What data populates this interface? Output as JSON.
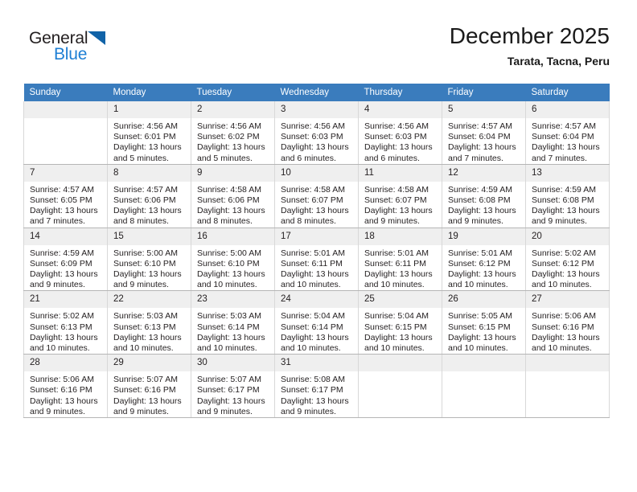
{
  "brand": {
    "name_part1": "General",
    "name_part2": "Blue",
    "logo_icon": "blue-triangle-icon"
  },
  "header": {
    "title": "December 2025",
    "location": "Tarata, Tacna, Peru"
  },
  "calendar": {
    "weekday_headers": [
      "Sunday",
      "Monday",
      "Tuesday",
      "Wednesday",
      "Thursday",
      "Friday",
      "Saturday"
    ],
    "labels": {
      "sunrise": "Sunrise:",
      "sunset": "Sunset:",
      "daylight": "Daylight:"
    },
    "weeks": [
      [
        {
          "day": "",
          "empty": true
        },
        {
          "day": "1",
          "sunrise": "Sunrise: 4:56 AM",
          "sunset": "Sunset: 6:01 PM",
          "daylight_line1": "Daylight: 13 hours",
          "daylight_line2": "and 5 minutes."
        },
        {
          "day": "2",
          "sunrise": "Sunrise: 4:56 AM",
          "sunset": "Sunset: 6:02 PM",
          "daylight_line1": "Daylight: 13 hours",
          "daylight_line2": "and 5 minutes."
        },
        {
          "day": "3",
          "sunrise": "Sunrise: 4:56 AM",
          "sunset": "Sunset: 6:03 PM",
          "daylight_line1": "Daylight: 13 hours",
          "daylight_line2": "and 6 minutes."
        },
        {
          "day": "4",
          "sunrise": "Sunrise: 4:56 AM",
          "sunset": "Sunset: 6:03 PM",
          "daylight_line1": "Daylight: 13 hours",
          "daylight_line2": "and 6 minutes."
        },
        {
          "day": "5",
          "sunrise": "Sunrise: 4:57 AM",
          "sunset": "Sunset: 6:04 PM",
          "daylight_line1": "Daylight: 13 hours",
          "daylight_line2": "and 7 minutes."
        },
        {
          "day": "6",
          "sunrise": "Sunrise: 4:57 AM",
          "sunset": "Sunset: 6:04 PM",
          "daylight_line1": "Daylight: 13 hours",
          "daylight_line2": "and 7 minutes."
        }
      ],
      [
        {
          "day": "7",
          "sunrise": "Sunrise: 4:57 AM",
          "sunset": "Sunset: 6:05 PM",
          "daylight_line1": "Daylight: 13 hours",
          "daylight_line2": "and 7 minutes."
        },
        {
          "day": "8",
          "sunrise": "Sunrise: 4:57 AM",
          "sunset": "Sunset: 6:06 PM",
          "daylight_line1": "Daylight: 13 hours",
          "daylight_line2": "and 8 minutes."
        },
        {
          "day": "9",
          "sunrise": "Sunrise: 4:58 AM",
          "sunset": "Sunset: 6:06 PM",
          "daylight_line1": "Daylight: 13 hours",
          "daylight_line2": "and 8 minutes."
        },
        {
          "day": "10",
          "sunrise": "Sunrise: 4:58 AM",
          "sunset": "Sunset: 6:07 PM",
          "daylight_line1": "Daylight: 13 hours",
          "daylight_line2": "and 8 minutes."
        },
        {
          "day": "11",
          "sunrise": "Sunrise: 4:58 AM",
          "sunset": "Sunset: 6:07 PM",
          "daylight_line1": "Daylight: 13 hours",
          "daylight_line2": "and 9 minutes."
        },
        {
          "day": "12",
          "sunrise": "Sunrise: 4:59 AM",
          "sunset": "Sunset: 6:08 PM",
          "daylight_line1": "Daylight: 13 hours",
          "daylight_line2": "and 9 minutes."
        },
        {
          "day": "13",
          "sunrise": "Sunrise: 4:59 AM",
          "sunset": "Sunset: 6:08 PM",
          "daylight_line1": "Daylight: 13 hours",
          "daylight_line2": "and 9 minutes."
        }
      ],
      [
        {
          "day": "14",
          "sunrise": "Sunrise: 4:59 AM",
          "sunset": "Sunset: 6:09 PM",
          "daylight_line1": "Daylight: 13 hours",
          "daylight_line2": "and 9 minutes."
        },
        {
          "day": "15",
          "sunrise": "Sunrise: 5:00 AM",
          "sunset": "Sunset: 6:10 PM",
          "daylight_line1": "Daylight: 13 hours",
          "daylight_line2": "and 9 minutes."
        },
        {
          "day": "16",
          "sunrise": "Sunrise: 5:00 AM",
          "sunset": "Sunset: 6:10 PM",
          "daylight_line1": "Daylight: 13 hours",
          "daylight_line2": "and 10 minutes."
        },
        {
          "day": "17",
          "sunrise": "Sunrise: 5:01 AM",
          "sunset": "Sunset: 6:11 PM",
          "daylight_line1": "Daylight: 13 hours",
          "daylight_line2": "and 10 minutes."
        },
        {
          "day": "18",
          "sunrise": "Sunrise: 5:01 AM",
          "sunset": "Sunset: 6:11 PM",
          "daylight_line1": "Daylight: 13 hours",
          "daylight_line2": "and 10 minutes."
        },
        {
          "day": "19",
          "sunrise": "Sunrise: 5:01 AM",
          "sunset": "Sunset: 6:12 PM",
          "daylight_line1": "Daylight: 13 hours",
          "daylight_line2": "and 10 minutes."
        },
        {
          "day": "20",
          "sunrise": "Sunrise: 5:02 AM",
          "sunset": "Sunset: 6:12 PM",
          "daylight_line1": "Daylight: 13 hours",
          "daylight_line2": "and 10 minutes."
        }
      ],
      [
        {
          "day": "21",
          "sunrise": "Sunrise: 5:02 AM",
          "sunset": "Sunset: 6:13 PM",
          "daylight_line1": "Daylight: 13 hours",
          "daylight_line2": "and 10 minutes."
        },
        {
          "day": "22",
          "sunrise": "Sunrise: 5:03 AM",
          "sunset": "Sunset: 6:13 PM",
          "daylight_line1": "Daylight: 13 hours",
          "daylight_line2": "and 10 minutes."
        },
        {
          "day": "23",
          "sunrise": "Sunrise: 5:03 AM",
          "sunset": "Sunset: 6:14 PM",
          "daylight_line1": "Daylight: 13 hours",
          "daylight_line2": "and 10 minutes."
        },
        {
          "day": "24",
          "sunrise": "Sunrise: 5:04 AM",
          "sunset": "Sunset: 6:14 PM",
          "daylight_line1": "Daylight: 13 hours",
          "daylight_line2": "and 10 minutes."
        },
        {
          "day": "25",
          "sunrise": "Sunrise: 5:04 AM",
          "sunset": "Sunset: 6:15 PM",
          "daylight_line1": "Daylight: 13 hours",
          "daylight_line2": "and 10 minutes."
        },
        {
          "day": "26",
          "sunrise": "Sunrise: 5:05 AM",
          "sunset": "Sunset: 6:15 PM",
          "daylight_line1": "Daylight: 13 hours",
          "daylight_line2": "and 10 minutes."
        },
        {
          "day": "27",
          "sunrise": "Sunrise: 5:06 AM",
          "sunset": "Sunset: 6:16 PM",
          "daylight_line1": "Daylight: 13 hours",
          "daylight_line2": "and 10 minutes."
        }
      ],
      [
        {
          "day": "28",
          "sunrise": "Sunrise: 5:06 AM",
          "sunset": "Sunset: 6:16 PM",
          "daylight_line1": "Daylight: 13 hours",
          "daylight_line2": "and 9 minutes."
        },
        {
          "day": "29",
          "sunrise": "Sunrise: 5:07 AM",
          "sunset": "Sunset: 6:16 PM",
          "daylight_line1": "Daylight: 13 hours",
          "daylight_line2": "and 9 minutes."
        },
        {
          "day": "30",
          "sunrise": "Sunrise: 5:07 AM",
          "sunset": "Sunset: 6:17 PM",
          "daylight_line1": "Daylight: 13 hours",
          "daylight_line2": "and 9 minutes."
        },
        {
          "day": "31",
          "sunrise": "Sunrise: 5:08 AM",
          "sunset": "Sunset: 6:17 PM",
          "daylight_line1": "Daylight: 13 hours",
          "daylight_line2": "and 9 minutes."
        },
        {
          "day": "",
          "empty": true
        },
        {
          "day": "",
          "empty": true
        },
        {
          "day": "",
          "empty": true
        }
      ]
    ]
  },
  "colors": {
    "header_blue": "#3a7cbd",
    "brand_blue": "#1e7fd4",
    "logo_triangle_blue": "#1163a8",
    "daynum_band": "#efefef",
    "cell_border": "#d8d8d8"
  }
}
